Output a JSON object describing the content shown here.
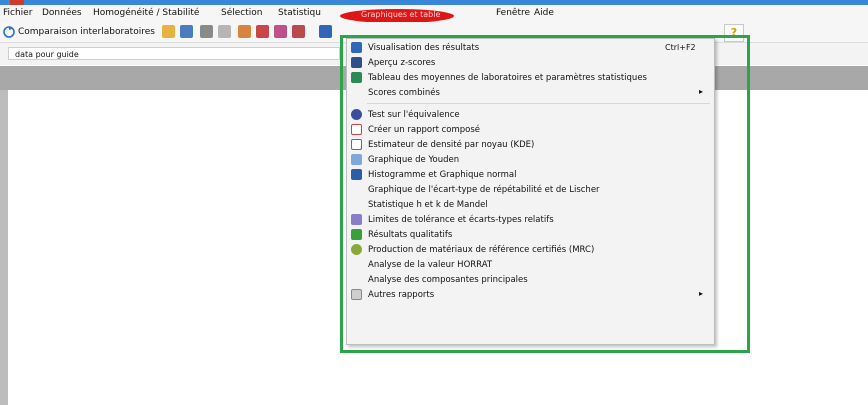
{
  "menubar": {
    "items": [
      "Fichier",
      "Données",
      "Homogénéité / Stabilité",
      "Sélection",
      "Statistiqu"
    ],
    "highlighted_menu": "Graphiques et table",
    "items_after": [
      "Fenêtre",
      "Aide"
    ]
  },
  "toolbar": {
    "main_button_label": "Comparaison interlaboratoires",
    "help_label": "?"
  },
  "document_field": {
    "value": "data pour guide"
  },
  "dropdown": {
    "items": [
      {
        "label": "Visualisation des résultats",
        "shortcut": "Ctrl+F2",
        "icon": "chart-window-icon"
      },
      {
        "label": "Aperçu z-scores",
        "icon": "z-score-icon"
      },
      {
        "label": "Tableau des moyennes de laboratoires et paramètres statistiques",
        "icon": "table-icon"
      },
      {
        "label": "Scores combinés",
        "icon": "none",
        "submenu": true
      },
      {
        "label": "Test sur l'équivalence",
        "icon": "equivalence-icon"
      },
      {
        "label": "Créer un rapport composé",
        "icon": "report-icon"
      },
      {
        "label": "Estimateur de densité par noyau (KDE)",
        "icon": "density-icon"
      },
      {
        "label": "Graphique de Youden",
        "icon": "youden-icon"
      },
      {
        "label": "Histogramme et Graphique normal",
        "icon": "histogram-icon"
      },
      {
        "label": "Graphique de l'écart-type de répétabilité et de Lischer",
        "icon": "none"
      },
      {
        "label": "Statistique h et k de Mandel",
        "icon": "none"
      },
      {
        "label": "Limites de tolérance et écarts-types relatifs",
        "icon": "tolerance-icon"
      },
      {
        "label": "Résultats qualitatifs",
        "icon": "qualitative-icon"
      },
      {
        "label": "Production de matériaux de référence certifiés (MRC)",
        "icon": "gear-icon"
      },
      {
        "label": "Analyse de la valeur HORRAT",
        "icon": "none"
      },
      {
        "label": "Analyse des composantes principales",
        "icon": "none"
      },
      {
        "label": "Autres rapports",
        "icon": "other-reports-icon",
        "submenu": true
      }
    ],
    "submenu_arrow": "▸"
  },
  "colors": {
    "highlight_ellipse": "#e01515",
    "green_frame": "#2ca44a"
  }
}
